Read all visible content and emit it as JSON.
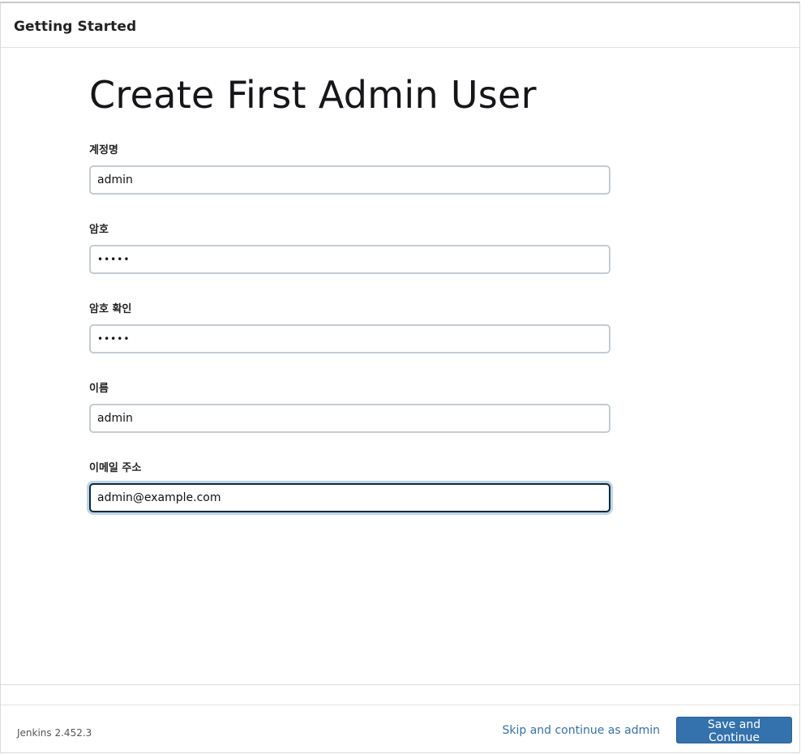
{
  "header": {
    "title": "Getting Started"
  },
  "main": {
    "title": "Create First Admin User",
    "fields": [
      {
        "label": "계정명",
        "value": "admin",
        "type": "text"
      },
      {
        "label": "암호",
        "value": "•••••",
        "type": "password"
      },
      {
        "label": "암호 확인",
        "value": "•••••",
        "type": "password"
      },
      {
        "label": "이름",
        "value": "admin",
        "type": "text"
      },
      {
        "label": "이메일 주소",
        "value": "admin@example.com",
        "type": "text",
        "focused": true
      }
    ]
  },
  "footer": {
    "version": "Jenkins 2.452.3",
    "skip_label": "Skip and continue as admin",
    "save_label": "Save and Continue"
  },
  "colors": {
    "primary_button": "#3372ad",
    "link": "#3572a8",
    "focus_ring": "#bcd6e8"
  }
}
